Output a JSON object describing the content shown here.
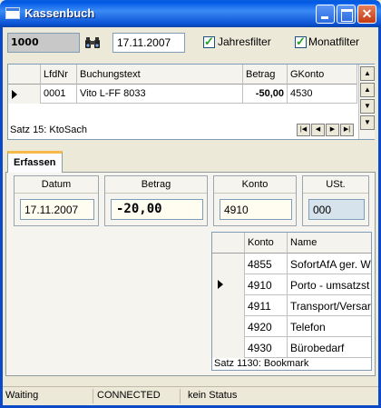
{
  "window": {
    "title": "Kassenbuch"
  },
  "toolbar": {
    "code_value": "1000",
    "search_icon": "binoculars-icon",
    "date_value": "17.11.2007",
    "jahresfilter_label": "Jahresfilter",
    "jahresfilter_checked": true,
    "monatfilter_label": "Monatfilter",
    "monatfilter_checked": true
  },
  "top_grid": {
    "columns": [
      "LfdNr",
      "Buchungstext",
      "Betrag",
      "GKonto"
    ],
    "rows": [
      {
        "lfdnr": "0001",
        "text": "Vito L-FF 8033",
        "betrag": "-50,00",
        "gkonto": "4530"
      }
    ],
    "status": "Satz 15: KtoSach"
  },
  "tabs": {
    "active": "Erfassen"
  },
  "form": {
    "datum_label": "Datum",
    "datum_value": "17.11.2007",
    "betrag_label": "Betrag",
    "betrag_value": "-20,00",
    "konto_label": "Konto",
    "konto_value": "4910",
    "ust_label": "USt.",
    "ust_value": "000"
  },
  "lookup_grid": {
    "columns": [
      "Konto",
      "Name"
    ],
    "rows": [
      {
        "konto": "4855",
        "name": "SofortAfA ger. Wi"
      },
      {
        "konto": "4910",
        "name": "Porto - umsatzst",
        "current": true
      },
      {
        "konto": "4911",
        "name": "Transport/Versar"
      },
      {
        "konto": "4920",
        "name": "Telefon"
      },
      {
        "konto": "4930",
        "name": "Bürobedarf"
      }
    ],
    "status": "Satz 1130: Bookmark"
  },
  "statusbar": {
    "state": "Waiting",
    "connection": "CONNECTED",
    "info": "kein Status"
  },
  "colors": {
    "titlebar": "#0a5fd8",
    "face": "#ece9d8",
    "input_active": "#fffdf0",
    "check": "#21a121"
  }
}
